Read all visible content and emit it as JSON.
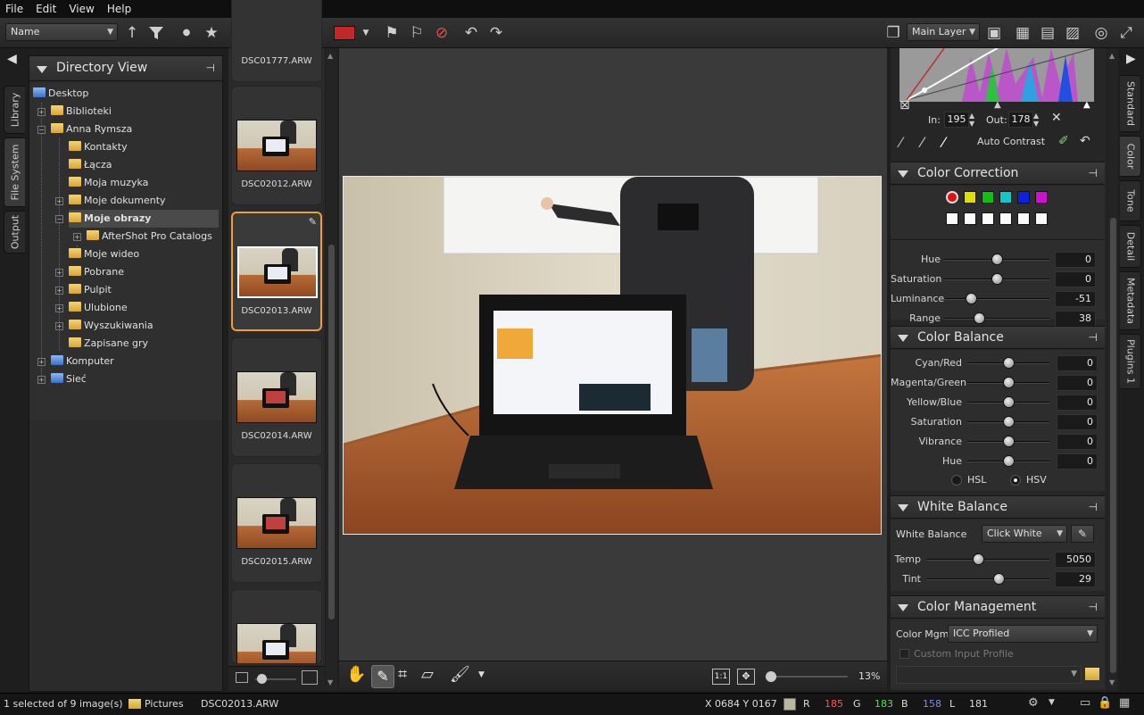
{
  "menu": {
    "file": "File",
    "edit": "Edit",
    "view": "View",
    "help": "Help"
  },
  "toolbar": {
    "sort_value": "Name",
    "layer_value": "Main Layer",
    "stars": 5,
    "color_label": "#c0282a"
  },
  "left_tabs": {
    "library": "Library",
    "file_system": "File System",
    "output": "Output"
  },
  "right_tabs": {
    "standard": "Standard",
    "color": "Color",
    "tone": "Tone",
    "detail": "Detail",
    "metadata": "Metadata",
    "plugins": "Plugins 1"
  },
  "directory": {
    "title": "Directory View",
    "items": [
      {
        "label": "Desktop"
      },
      {
        "label": "Biblioteki"
      },
      {
        "label": "Anna Rymsza"
      },
      {
        "label": "Kontakty"
      },
      {
        "label": "Łącza"
      },
      {
        "label": "Moja muzyka"
      },
      {
        "label": "Moje dokumenty"
      },
      {
        "label": "Moje obrazy"
      },
      {
        "label": "AfterShot Pro Catalogs"
      },
      {
        "label": "Moje wideo"
      },
      {
        "label": "Pobrane"
      },
      {
        "label": "Pulpit"
      },
      {
        "label": "Ulubione"
      },
      {
        "label": "Wyszukiwania"
      },
      {
        "label": "Zapisane gry"
      },
      {
        "label": "Komputer"
      },
      {
        "label": "Sieć"
      }
    ]
  },
  "filmstrip": {
    "thumbs": [
      {
        "label": "DSC01777.ARW"
      },
      {
        "label": "DSC02012.ARW"
      },
      {
        "label": "DSC02013.ARW"
      },
      {
        "label": "DSC02014.ARW"
      },
      {
        "label": "DSC02015.ARW"
      }
    ]
  },
  "viewer": {
    "zoom": "13%",
    "one_to_one": "1:1"
  },
  "curves": {
    "in_label": "In:",
    "in_value": "195",
    "out_label": "Out:",
    "out_value": "178",
    "auto_contrast": "Auto Contrast"
  },
  "color_correction": {
    "title": "Color Correction",
    "swatches": [
      "#e01010",
      "#e0e000",
      "#10c010",
      "#10c8c8",
      "#1020e0",
      "#d010d0"
    ],
    "sliders": [
      {
        "label": "Hue",
        "value": "0",
        "pos": 0.5
      },
      {
        "label": "Saturation",
        "value": "0",
        "pos": 0.5
      },
      {
        "label": "Luminance",
        "value": "-51",
        "pos": 0.25
      },
      {
        "label": "Range",
        "value": "38",
        "pos": 0.33
      }
    ]
  },
  "color_balance": {
    "title": "Color Balance",
    "sliders": [
      {
        "label": "Cyan/Red",
        "value": "0",
        "pos": 0.5
      },
      {
        "label": "Magenta/Green",
        "value": "0",
        "pos": 0.5
      },
      {
        "label": "Yellow/Blue",
        "value": "0",
        "pos": 0.5
      },
      {
        "label": "Saturation",
        "value": "0",
        "pos": 0.5
      },
      {
        "label": "Vibrance",
        "value": "0",
        "pos": 0.5
      },
      {
        "label": "Hue",
        "value": "0",
        "pos": 0.5
      }
    ],
    "hsl": "HSL",
    "hsv": "HSV"
  },
  "white_balance": {
    "title": "White Balance",
    "label": "White Balance",
    "mode": "Click White",
    "temp_label": "Temp",
    "temp_value": "5050",
    "temp_pos": 0.42,
    "tint_label": "Tint",
    "tint_value": "29",
    "tint_pos": 0.59
  },
  "color_management": {
    "title": "Color Management",
    "label": "Color Mgmt",
    "value": "ICC Profiled",
    "custom_input": "Custom Input Profile"
  },
  "status": {
    "selection": "1 selected of 9 image(s)",
    "folder": "Pictures",
    "file": "DSC02013.ARW",
    "coords": "X 0684  Y 0167",
    "r_label": "R",
    "r_value": "185",
    "g_label": "G",
    "g_value": "183",
    "b_label": "B",
    "b_value": "158",
    "l_label": "L",
    "l_value": "181"
  }
}
